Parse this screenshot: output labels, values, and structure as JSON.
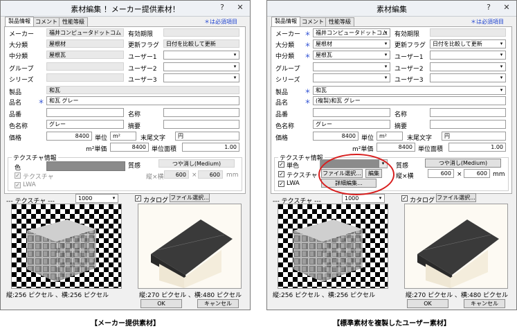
{
  "left": {
    "title": "素材編集 ！メーカー提供素材！",
    "help": "?",
    "close": "✕",
    "tabs": [
      "製品情報",
      "コメント",
      "性能等級"
    ],
    "required_note": "＊は必須項目",
    "fields": {
      "maker_label": "メーカー",
      "maker_value": "福井コンピュータドットコム",
      "major_label": "大分類",
      "major_value": "屋根材",
      "minor_label": "中分類",
      "minor_value": "屋根瓦",
      "group_label": "グループ",
      "series_label": "シリーズ",
      "expiry_label": "有効期限",
      "update_label": "更新フラグ",
      "update_value": "日付を比較して更新",
      "user1_label": "ユーザー1",
      "user2_label": "ユーザー2",
      "user3_label": "ユーザー3",
      "product_label": "製品",
      "product_value": "和瓦",
      "name_label": "品名",
      "name_value": "和瓦 グレー",
      "number_label": "品番",
      "spec_label": "名称",
      "colorname_label": "色名称",
      "colorname_value": "グレー",
      "summary_label": "摘要",
      "price_label": "価格",
      "price_value": "8400",
      "unit_label": "単位",
      "unit_value": "m²",
      "suffix_label": "末尾文字",
      "suffix_value": "円",
      "unitprice_label": "m²単価",
      "unitprice_value": "8400",
      "unitarea_label": "単位面積",
      "unitarea_value": "1.00"
    },
    "texture": {
      "group_label": "テクスチャ情報",
      "color_label": "色",
      "texture_label": "テクスチャ",
      "lwa_label": "LWA",
      "quality_label": "質感",
      "quality_value": "つや消し(Medium)",
      "size_label": "縦×横",
      "w": "600",
      "x": "×",
      "h": "600",
      "mm": "mm"
    },
    "lower": {
      "texture_label": "--- テクスチャ ---",
      "res_value": "1000",
      "catalog_label": "カタログ",
      "file_select": "ファイル選択...",
      "tex_info": "縦:256 ピクセル 、横:256 ピクセル",
      "cat_info": "縦:270 ピクセル 、横:480 ピクセル",
      "ok": "OK",
      "cancel": "キャンセル"
    },
    "caption": "【メーカー提供素材】"
  },
  "right": {
    "title": "素材編集",
    "help": "?",
    "close": "✕",
    "tabs": [
      "製品情報",
      "コメント",
      "性能等級"
    ],
    "required_note": "＊は必須項目",
    "fields": {
      "maker_label": "メーカー",
      "maker_value": "福井コンピュータドットコム",
      "major_label": "大分類",
      "major_value": "屋根材",
      "minor_label": "中分類",
      "minor_value": "屋根瓦",
      "group_label": "グループ",
      "series_label": "シリーズ",
      "expiry_label": "有効期限",
      "update_label": "更新フラグ",
      "update_value": "日付を比較して更新",
      "user1_label": "ユーザー1",
      "user2_label": "ユーザー2",
      "user3_label": "ユーザー3",
      "product_label": "製品",
      "product_value": "和瓦",
      "name_label": "品名",
      "name_value": "(複製)和瓦 グレー",
      "number_label": "品番",
      "spec_label": "名称",
      "colorname_label": "色名称",
      "colorname_value": "グレー",
      "summary_label": "摘要",
      "price_label": "価格",
      "price_value": "8400",
      "unit_label": "単位",
      "unit_value": "m²",
      "suffix_label": "末尾文字",
      "suffix_value": "円",
      "unitprice_label": "m²単価",
      "unitprice_value": "8400",
      "unitarea_label": "単位面積",
      "unitarea_value": "1.00"
    },
    "texture": {
      "group_label": "テクスチャ情報",
      "single_color_label": "単色",
      "texture_label": "テクスチャ",
      "lwa_label": "LWA",
      "quality_label": "質感",
      "quality_value": "つや消し(Medium)",
      "file_select": "ファイル選択...",
      "edit": "編集",
      "detail_edit": "詳細編集...",
      "size_label": "縦×横",
      "w": "600",
      "x": "×",
      "h": "600",
      "mm": "mm"
    },
    "lower": {
      "texture_label": "--- テクスチャ ---",
      "res_value": "1000",
      "catalog_label": "カタログ",
      "file_select": "ファイル選択...",
      "tex_info": "縦:256 ピクセル 、横:256 ピクセル",
      "cat_info": "縦:270 ピクセル 、横:480 ピクセル",
      "ok": "OK",
      "cancel": "キャンセル"
    },
    "caption": "【標準素材を複製したユーザー素材】"
  },
  "colors": {
    "required": "#1a3fcf",
    "highlight": "#d81f1f",
    "swatch": "#8b8b8b"
  }
}
